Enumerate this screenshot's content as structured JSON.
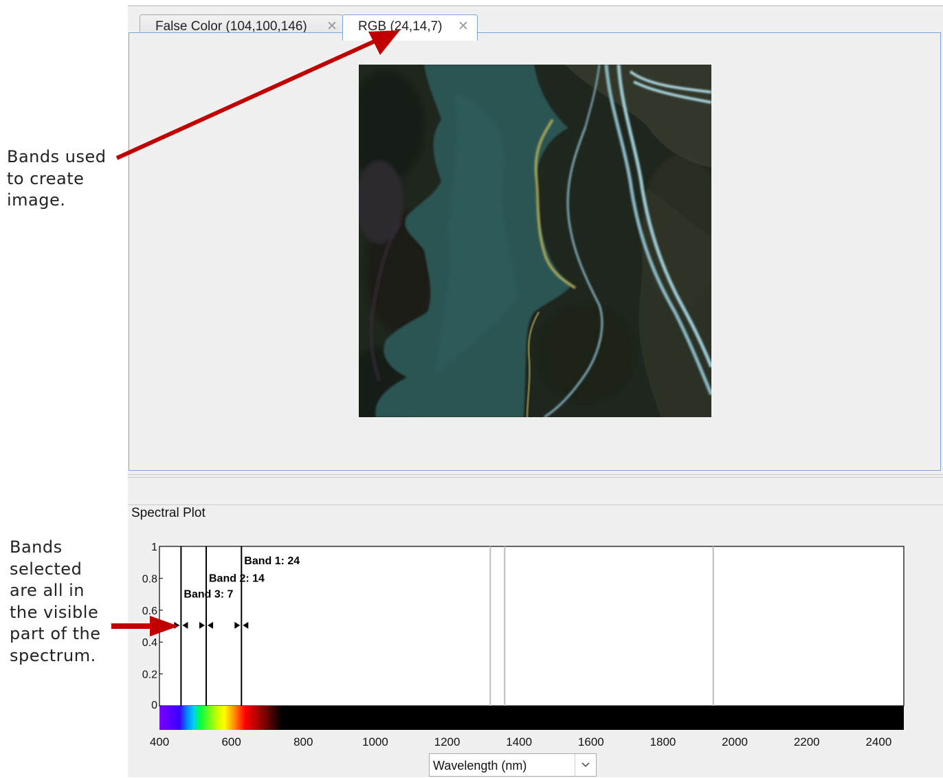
{
  "tabs": [
    {
      "label": "False Color (104,100,146)",
      "active": false
    },
    {
      "label": "RGB (24,14,7)",
      "active": true
    }
  ],
  "annotations": {
    "bands_used": "Bands used\nto create\nimage.",
    "bands_selected": "Bands\nselected\nare all in\nthe visible\npart of the\nspectrum."
  },
  "spectral_panel": {
    "title": "Spectral Plot",
    "xaxis_selector": {
      "value": "Wavelength (nm)"
    }
  },
  "chart_data": {
    "type": "line",
    "xlim": [
      400,
      2470
    ],
    "ylim": [
      0,
      1
    ],
    "xticks": [
      400,
      600,
      800,
      1000,
      1200,
      1400,
      1600,
      1800,
      2000,
      2200,
      2400
    ],
    "yticks": [
      0,
      0.2,
      0.4,
      0.6,
      0.8,
      1
    ],
    "ytick_labels": [
      "0",
      "0.2",
      "0.4",
      "0.6",
      "0.8",
      "1"
    ],
    "band_markers": [
      {
        "label": "Band 1: 24",
        "wavelength": 628,
        "label_y": 0.91
      },
      {
        "label": "Band 2: 14",
        "wavelength": 530,
        "label_y": 0.8
      },
      {
        "label": "Band 3: 7",
        "wavelength": 460,
        "label_y": 0.7
      }
    ],
    "gray_lines": [
      1320,
      1360,
      1940
    ],
    "colors": {
      "band_line": "#000000",
      "gray_line": "#bdbdbd",
      "annotation_arrow": "#c00000"
    }
  }
}
